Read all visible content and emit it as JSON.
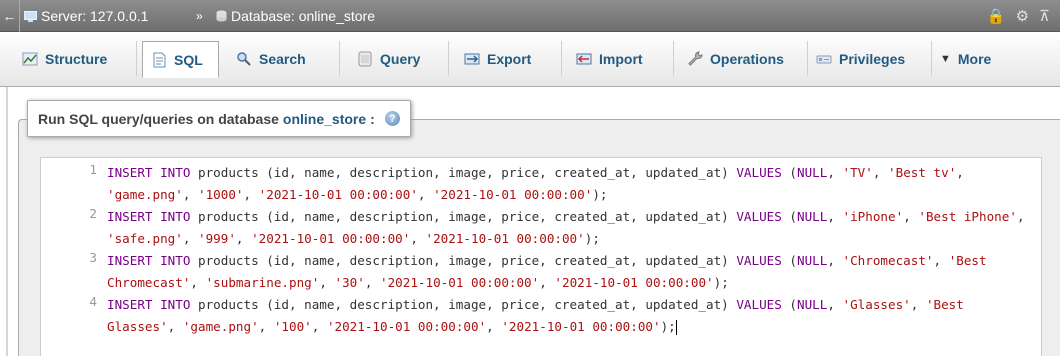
{
  "breadcrumb": {
    "server_label": "Server: 127.0.0.1",
    "separator": "»",
    "database_label": "Database: online_store"
  },
  "tabs": [
    {
      "label": "Structure",
      "icon": "structure-icon"
    },
    {
      "label": "SQL",
      "icon": "sql-icon",
      "active": true
    },
    {
      "label": "Search",
      "icon": "search-icon"
    },
    {
      "label": "Query",
      "icon": "query-icon"
    },
    {
      "label": "Export",
      "icon": "export-icon"
    },
    {
      "label": "Import",
      "icon": "import-icon"
    },
    {
      "label": "Operations",
      "icon": "wrench-icon"
    },
    {
      "label": "Privileges",
      "icon": "privileges-icon"
    },
    {
      "label": "More",
      "icon": "triangle-down-icon"
    }
  ],
  "panel": {
    "legend_prefix": "Run SQL query/queries on database",
    "database_name": "online_store",
    "legend_suffix": ":"
  },
  "editor": {
    "lines": [
      {
        "number": "1",
        "tokens": [
          [
            "kw",
            "INSERT INTO"
          ],
          [
            "plain",
            " products (id, name, description, image, price, created_at, updated_at) "
          ],
          [
            "kw",
            "VALUES"
          ],
          [
            "plain",
            " ("
          ],
          [
            "kw",
            "NULL"
          ],
          [
            "plain",
            ", "
          ],
          [
            "str",
            "'TV'"
          ],
          [
            "plain",
            ", "
          ],
          [
            "str",
            "'Best tv'"
          ],
          [
            "plain",
            ", "
          ],
          [
            "str",
            "'game.png'"
          ],
          [
            "plain",
            ", "
          ],
          [
            "str",
            "'1000'"
          ],
          [
            "plain",
            ", "
          ],
          [
            "str",
            "'2021-10-01 00:00:00'"
          ],
          [
            "plain",
            ", "
          ],
          [
            "str",
            "'2021-10-01 00:00:00'"
          ],
          [
            "plain",
            ");"
          ]
        ]
      },
      {
        "number": "2",
        "tokens": [
          [
            "kw",
            "INSERT INTO"
          ],
          [
            "plain",
            " products (id, name, description, image, price, created_at, updated_at) "
          ],
          [
            "kw",
            "VALUES"
          ],
          [
            "plain",
            " ("
          ],
          [
            "kw",
            "NULL"
          ],
          [
            "plain",
            ", "
          ],
          [
            "str",
            "'iPhone'"
          ],
          [
            "plain",
            ", "
          ],
          [
            "str",
            "'Best iPhone'"
          ],
          [
            "plain",
            ", "
          ],
          [
            "str",
            "'safe.png'"
          ],
          [
            "plain",
            ", "
          ],
          [
            "str",
            "'999'"
          ],
          [
            "plain",
            ", "
          ],
          [
            "str",
            "'2021-10-01 00:00:00'"
          ],
          [
            "plain",
            ", "
          ],
          [
            "str",
            "'2021-10-01 00:00:00'"
          ],
          [
            "plain",
            ");"
          ]
        ]
      },
      {
        "number": "3",
        "tokens": [
          [
            "kw",
            "INSERT INTO"
          ],
          [
            "plain",
            " products (id, name, description, image, price, created_at, updated_at) "
          ],
          [
            "kw",
            "VALUES"
          ],
          [
            "plain",
            " ("
          ],
          [
            "kw",
            "NULL"
          ],
          [
            "plain",
            ", "
          ],
          [
            "str",
            "'Chromecast'"
          ],
          [
            "plain",
            ", "
          ],
          [
            "str",
            "'Best Chromecast'"
          ],
          [
            "plain",
            ", "
          ],
          [
            "str",
            "'submarine.png'"
          ],
          [
            "plain",
            ", "
          ],
          [
            "str",
            "'30'"
          ],
          [
            "plain",
            ", "
          ],
          [
            "str",
            "'2021-10-01 00:00:00'"
          ],
          [
            "plain",
            ", "
          ],
          [
            "str",
            "'2021-10-01 00:00:00'"
          ],
          [
            "plain",
            ");"
          ]
        ]
      },
      {
        "number": "4",
        "tokens": [
          [
            "kw",
            "INSERT INTO"
          ],
          [
            "plain",
            " products (id, name, description, image, price, created_at, updated_at) "
          ],
          [
            "kw",
            "VALUES"
          ],
          [
            "plain",
            " ("
          ],
          [
            "kw",
            "NULL"
          ],
          [
            "plain",
            ", "
          ],
          [
            "str",
            "'Glasses'"
          ],
          [
            "plain",
            ", "
          ],
          [
            "str",
            "'Best Glasses'"
          ],
          [
            "plain",
            ", "
          ],
          [
            "str",
            "'game.png'"
          ],
          [
            "plain",
            ", "
          ],
          [
            "str",
            "'100'"
          ],
          [
            "plain",
            ", "
          ],
          [
            "str",
            "'2021-10-01 00:00:00'"
          ],
          [
            "plain",
            ", "
          ],
          [
            "str",
            "'2021-10-01 00:00:00'"
          ],
          [
            "plain",
            ");"
          ]
        ]
      }
    ]
  },
  "colors": {
    "link": "#235a81",
    "keyword": "#770088",
    "string": "#aa1111"
  }
}
